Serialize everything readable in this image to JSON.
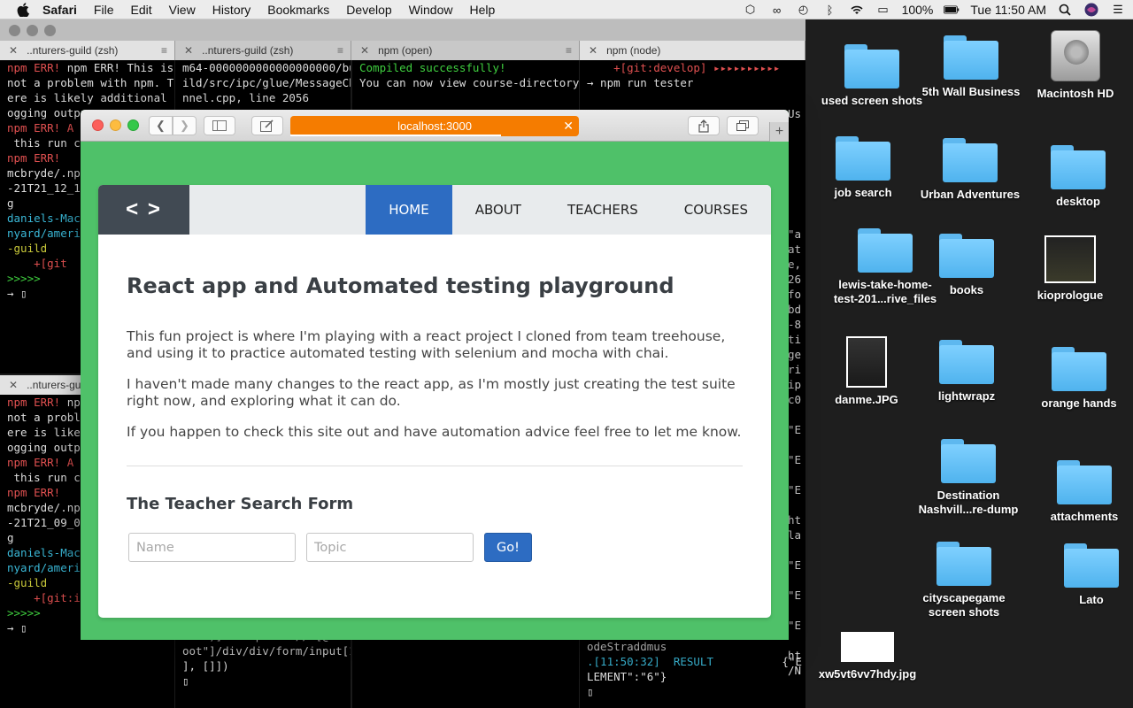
{
  "menubar": {
    "app": "Safari",
    "items": [
      "File",
      "Edit",
      "View",
      "History",
      "Bookmarks",
      "Develop",
      "Window",
      "Help"
    ],
    "battery": "100%",
    "clock": "Tue 11:50 AM"
  },
  "terminal": {
    "tabs": [
      "..nturers-guild (zsh)",
      "..nturers-guild (zsh)",
      "npm (open)",
      "npm (node)",
      "..nturers-guild"
    ],
    "pane1": [
      "npm ERR! This is probably",
      "not a problem with npm. Th",
      "ere is likely additional l",
      "ogging outpu",
      "",
      "npm ERR! A c",
      " this run co",
      "npm ERR!",
      "mcbryde/.npm",
      "-21T21_12_14",
      "g",
      "",
      "",
      "daniels-MacB",
      "nyard/americ",
      "-guild",
      "",
      "    +[git",
      ">>>>>",
      "→ ▯"
    ],
    "pane2": [
      "m64-0000000000000000000/bu",
      "ild/src/ipc/glue/MessageCha",
      "nnel.cpp, line 2056"
    ],
    "pane3": [
      "Compiled successfully!",
      "",
      "You can now view course-directory i"
    ],
    "pane4": [
      "    +[git:develop] ▸▸▸▸▸▸▸▸▸▸",
      "→ npm run tester"
    ],
    "pane5": [
      "npm ERR! Thi",
      "not a proble",
      "ere is likel",
      "ogging outpu",
      "",
      "npm ERR! A c",
      " this run co",
      "npm ERR!",
      "mcbryde/.npm",
      "-21T21_09_00",
      "g",
      "",
      "",
      "daniels-MacB",
      "nyard/americ",
      "-guild",
      "",
      "    +[git:index2] ▸▸▸▸▸",
      ">>>>>",
      "→ ▯"
    ],
    "pane6": [
      "E36D)] -> xpath: //*[@id=\"r",
      "oot\"]/div/div/form/input[1]",
      "], []])",
      "▯"
    ],
    "pane7": [
      "odeStraddmus",
      ".[11:50:32]  RESULT",
      "LEMENT\":\"6\"}",
      "▯"
    ],
    "pane7_right": "{\"E",
    "right_col": [
      "Us",
      "",
      "",
      "",
      "",
      "",
      "",
      "",
      "\"a",
      "at",
      "e,",
      "26",
      "fo",
      "bd",
      "-8",
      "ti",
      "ge",
      "ri",
      "ip",
      "c0",
      "",
      "\"E",
      "",
      "\"E",
      "",
      "\"E",
      "",
      "ht",
      "la",
      "",
      "\"E",
      "",
      "\"E",
      "",
      "\"E",
      "",
      "ht",
      "/N"
    ]
  },
  "safari": {
    "url": "localhost:3000",
    "accent": "#f57c00",
    "page_bg": "#4fc169"
  },
  "page": {
    "logo": "< >",
    "nav": [
      "HOME",
      "ABOUT",
      "TEACHERS",
      "COURSES"
    ],
    "active_nav": "HOME",
    "title": "React app and Automated testing playground",
    "paragraphs": [
      "This fun project is where I'm playing with a react project I cloned from team treehouse, and using it to practice automated testing with selenium and mocha with chai.",
      "I haven't made many changes to the react app, as I'm mostly just creating the test suite right now, and exploring what it can do.",
      "If you happen to check this site out and have automation advice feel free to let me know."
    ],
    "form_title": "The Teacher Search Form",
    "name_placeholder": "Name",
    "topic_placeholder": "Topic",
    "go_label": "Go!",
    "brand_blue": "#2d6cc2"
  },
  "desktop": {
    "icons": [
      "used screen shots",
      "5th Wall Business",
      "Macintosh HD",
      "job search",
      "Urban Adventures",
      "desktop",
      "lewis-take-home-test-201...rive_files",
      "books",
      "kioprologue",
      "danme.JPG",
      "lightwrapz",
      "orange hands",
      "Destination Nashvill...re-dump",
      "attachments",
      "cityscapegame screen shots",
      "Lato",
      "xw5vt6vv7hdy.jpg"
    ]
  }
}
